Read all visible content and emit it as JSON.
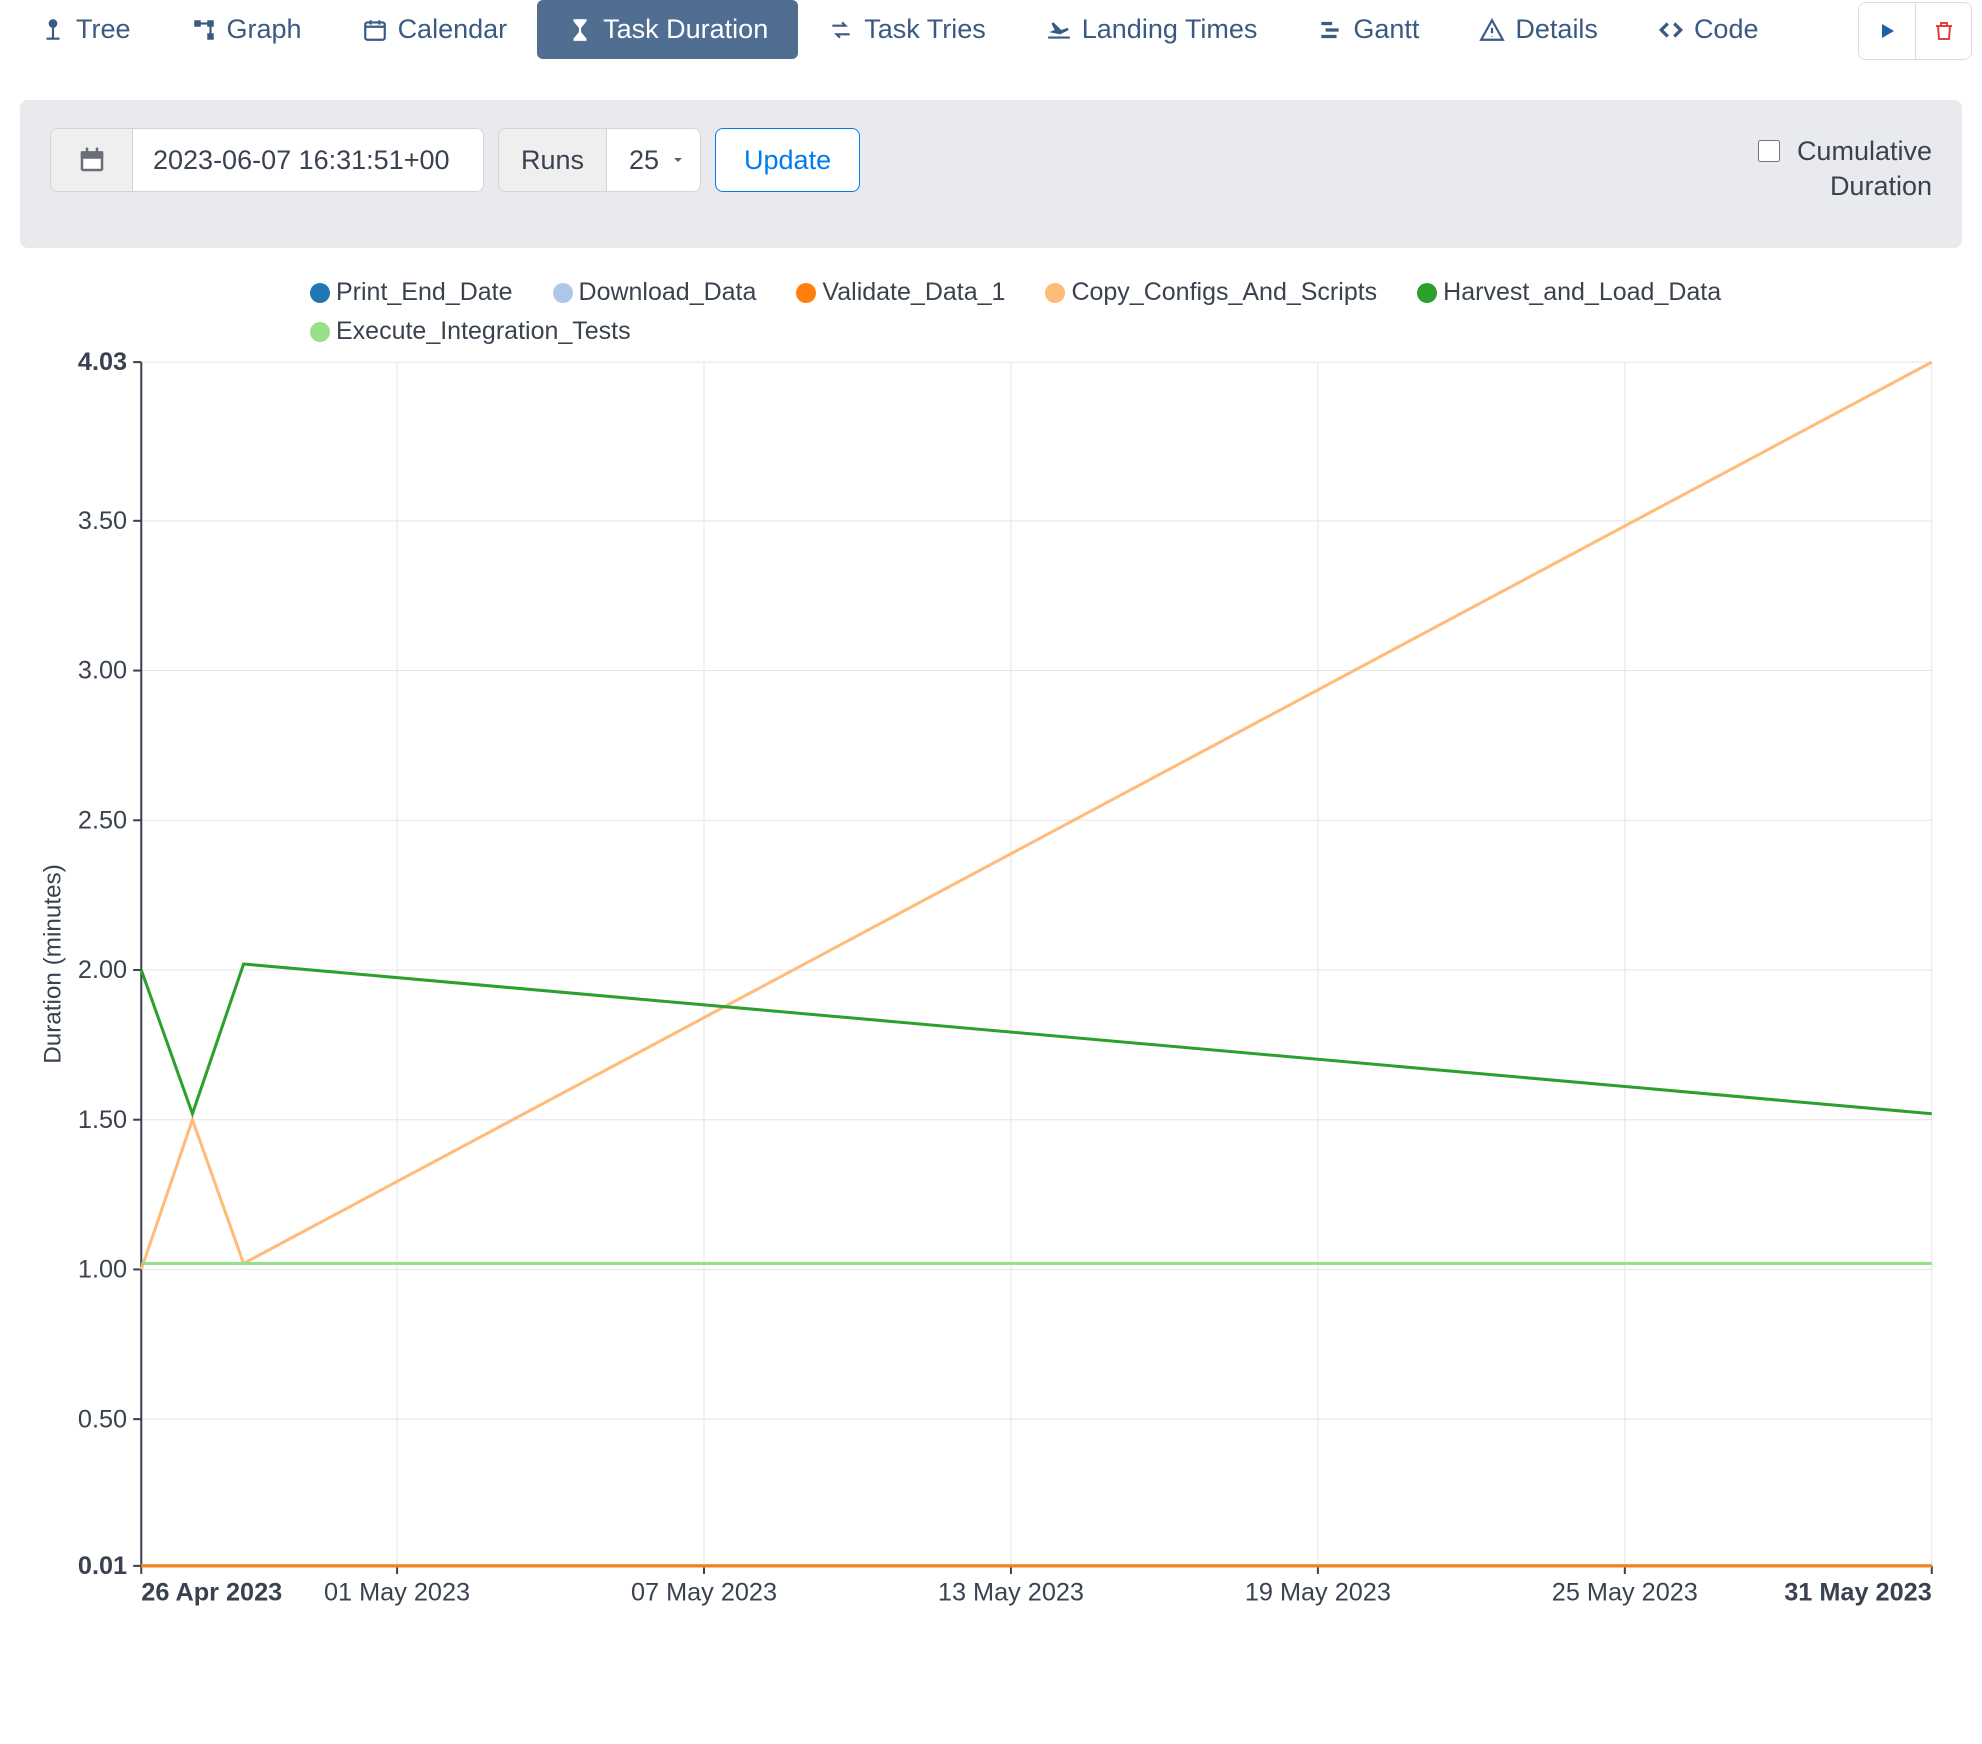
{
  "tabs": {
    "tree": "Tree",
    "graph": "Graph",
    "calendar": "Calendar",
    "task_duration": "Task Duration",
    "task_tries": "Task Tries",
    "landing_times": "Landing Times",
    "gantt": "Gantt",
    "details": "Details",
    "code": "Code",
    "active": "task_duration"
  },
  "controls": {
    "date_value": "2023-06-07 16:31:51+00",
    "runs_label": "Runs",
    "runs_value": "25",
    "update_label": "Update",
    "cumulative_label_line1": "Cumulative",
    "cumulative_label_line2": "Duration",
    "cumulative_checked": false
  },
  "chart_data": {
    "type": "line",
    "ylabel": "Duration (minutes)",
    "ylim": [
      0.01,
      4.03
    ],
    "y_ticks": [
      0.01,
      0.5,
      1.0,
      1.5,
      2.0,
      2.5,
      3.0,
      3.5,
      4.03
    ],
    "x_ticks": [
      "26 Apr 2023",
      "01 May 2023",
      "07 May 2023",
      "13 May 2023",
      "19 May 2023",
      "25 May 2023",
      "31 May 2023"
    ],
    "x": [
      "26 Apr 2023",
      "27 Apr 2023",
      "28 Apr 2023",
      "31 May 2023"
    ],
    "series": [
      {
        "name": "Print_End_Date",
        "color": "#1f77b4",
        "values": [
          0.01,
          0.01,
          0.01,
          0.01
        ]
      },
      {
        "name": "Download_Data",
        "color": "#aec7e8",
        "values": [
          0.01,
          0.01,
          0.01,
          0.01
        ]
      },
      {
        "name": "Validate_Data_1",
        "color": "#ff7f0e",
        "values": [
          0.01,
          0.01,
          0.01,
          0.01
        ]
      },
      {
        "name": "Copy_Configs_And_Scripts",
        "color": "#ffbb78",
        "values": [
          1.0,
          1.5,
          1.02,
          4.03
        ]
      },
      {
        "name": "Harvest_and_Load_Data",
        "color": "#2ca02c",
        "values": [
          2.0,
          1.52,
          2.02,
          1.52
        ]
      },
      {
        "name": "Execute_Integration_Tests",
        "color": "#98df8a",
        "values": [
          1.02,
          1.02,
          1.02,
          1.02
        ]
      }
    ]
  }
}
